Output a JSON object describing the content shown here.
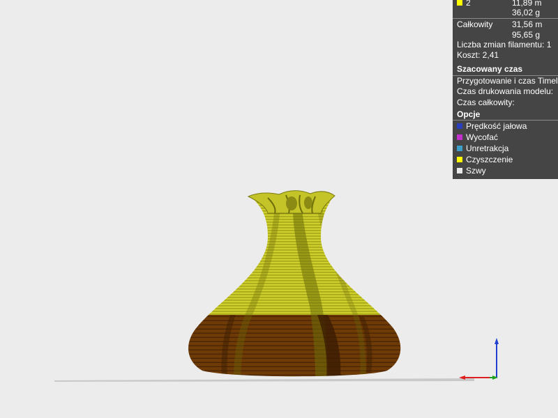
{
  "legend": {
    "filament_row": {
      "index": "2",
      "swatch_color": "#ffff00",
      "length": "11,89 m",
      "weight": "36,02 g"
    },
    "total": {
      "label": "Całkowity",
      "length": "31,56 m",
      "weight": "95,65 g"
    },
    "filament_changes": "Liczba zmian filamentu: 1",
    "cost": "Koszt: 2,41",
    "estimated_time": {
      "heading": "Szacowany czas",
      "prepare": "Przygotowanie i czas Timelapse:",
      "model_print": "Czas drukowania modelu:",
      "total_time": "Czas całkowity:"
    },
    "options": {
      "heading": "Opcje",
      "items": [
        {
          "label": "Prędkość jałowa",
          "color": "#2a3fc0",
          "icon": "travel-swatch"
        },
        {
          "label": "Wycofać",
          "color": "#c42fd0",
          "icon": "retract-swatch"
        },
        {
          "label": "Unretrakcja",
          "color": "#3aa0c8",
          "icon": "unretract-swatch"
        },
        {
          "label": "Czyszczenie",
          "color": "#ffff00",
          "icon": "wipe-swatch"
        },
        {
          "label": "Szwy",
          "color": "#e8e8e8",
          "icon": "seams-swatch"
        }
      ]
    }
  },
  "scene": {
    "upper_color": "#c8c827",
    "lower_color": "#6b3805",
    "axis_colors": {
      "x": "#e02020",
      "y": "#20a020",
      "z": "#2040d0"
    }
  }
}
